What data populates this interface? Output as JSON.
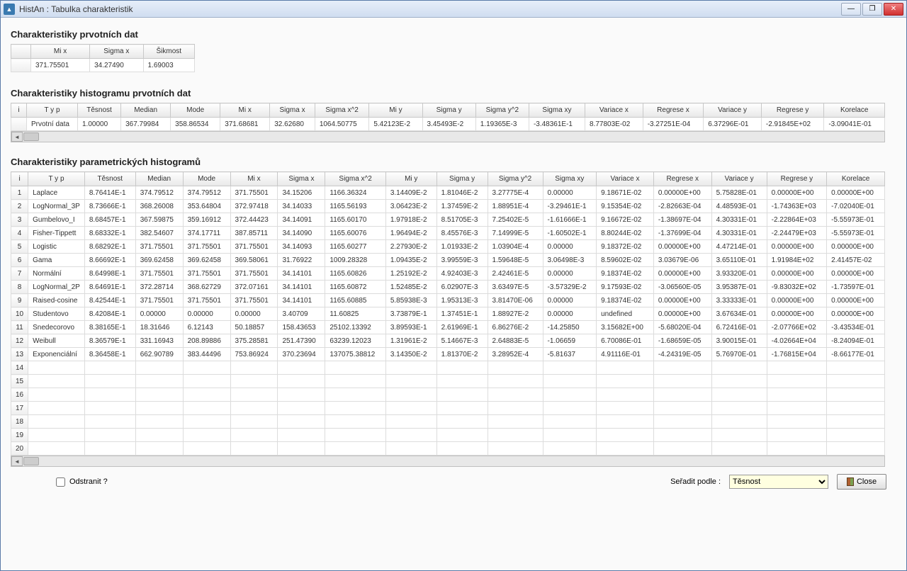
{
  "window": {
    "title": "HistAn : Tabulka charakteristik"
  },
  "section1": {
    "title": "Charakteristiky prvotních dat",
    "headers": [
      "Mi x",
      "Sigma x",
      "Šikmost"
    ],
    "row": [
      "371.75501",
      "34.27490",
      "1.69003"
    ]
  },
  "section2": {
    "title": "Charakteristiky histogramu prvotních dat",
    "headers": [
      "i",
      "T y p",
      "Těsnost",
      "Median",
      "Mode",
      "Mi x",
      "Sigma x",
      "Sigma x^2",
      "Mi y",
      "Sigma y",
      "Sigma y^2",
      "Sigma xy",
      "Variace x",
      "Regrese x",
      "Variace y",
      "Regrese y",
      "Korelace"
    ],
    "row": [
      "",
      "Prvotní data",
      "1.00000",
      "367.79984",
      "358.86534",
      "371.68681",
      "32.62680",
      "1064.50775",
      "5.42123E-2",
      "3.45493E-2",
      "1.19365E-3",
      "-3.48361E-1",
      "8.77803E-02",
      "-3.27251E-04",
      "6.37296E-01",
      "-2.91845E+02",
      "-3.09041E-01"
    ]
  },
  "section3": {
    "title": "Charakteristiky parametrických histogramů",
    "headers": [
      "i",
      "T y p",
      "Těsnost",
      "Median",
      "Mode",
      "Mi x",
      "Sigma x",
      "Sigma x^2",
      "Mi y",
      "Sigma y",
      "Sigma y^2",
      "Sigma xy",
      "Variace x",
      "Regrese x",
      "Variace y",
      "Regrese y",
      "Korelace"
    ],
    "rows": [
      [
        "1",
        "Laplace",
        "8.76414E-1",
        "374.79512",
        "374.79512",
        "371.75501",
        "34.15206",
        "1166.36324",
        "3.14409E-2",
        "1.81046E-2",
        "3.27775E-4",
        "0.00000",
        "9.18671E-02",
        "0.00000E+00",
        "5.75828E-01",
        "0.00000E+00",
        "0.00000E+00"
      ],
      [
        "2",
        "LogNormal_3P",
        "8.73666E-1",
        "368.26008",
        "353.64804",
        "372.97418",
        "34.14033",
        "1165.56193",
        "3.06423E-2",
        "1.37459E-2",
        "1.88951E-4",
        "-3.29461E-1",
        "9.15354E-02",
        "-2.82663E-04",
        "4.48593E-01",
        "-1.74363E+03",
        "-7.02040E-01"
      ],
      [
        "3",
        "Gumbelovo_I",
        "8.68457E-1",
        "367.59875",
        "359.16912",
        "372.44423",
        "34.14091",
        "1165.60170",
        "1.97918E-2",
        "8.51705E-3",
        "7.25402E-5",
        "-1.61666E-1",
        "9.16672E-02",
        "-1.38697E-04",
        "4.30331E-01",
        "-2.22864E+03",
        "-5.55973E-01"
      ],
      [
        "4",
        "Fisher-Tippett",
        "8.68332E-1",
        "382.54607",
        "374.17711",
        "387.85711",
        "34.14090",
        "1165.60076",
        "1.96494E-2",
        "8.45576E-3",
        "7.14999E-5",
        "-1.60502E-1",
        "8.80244E-02",
        "-1.37699E-04",
        "4.30331E-01",
        "-2.24479E+03",
        "-5.55973E-01"
      ],
      [
        "5",
        "Logistic",
        "8.68292E-1",
        "371.75501",
        "371.75501",
        "371.75501",
        "34.14093",
        "1165.60277",
        "2.27930E-2",
        "1.01933E-2",
        "1.03904E-4",
        "0.00000",
        "9.18372E-02",
        "0.00000E+00",
        "4.47214E-01",
        "0.00000E+00",
        "0.00000E+00"
      ],
      [
        "6",
        "Gama",
        "8.66692E-1",
        "369.62458",
        "369.62458",
        "369.58061",
        "31.76922",
        "1009.28328",
        "1.09435E-2",
        "3.99559E-3",
        "1.59648E-5",
        "3.06498E-3",
        "8.59602E-02",
        "3.03679E-06",
        "3.65110E-01",
        "1.91984E+02",
        "2.41457E-02"
      ],
      [
        "7",
        "Normální",
        "8.64998E-1",
        "371.75501",
        "371.75501",
        "371.75501",
        "34.14101",
        "1165.60826",
        "1.25192E-2",
        "4.92403E-3",
        "2.42461E-5",
        "0.00000",
        "9.18374E-02",
        "0.00000E+00",
        "3.93320E-01",
        "0.00000E+00",
        "0.00000E+00"
      ],
      [
        "8",
        "LogNormal_2P",
        "8.64691E-1",
        "372.28714",
        "368.62729",
        "372.07161",
        "34.14101",
        "1165.60872",
        "1.52485E-2",
        "6.02907E-3",
        "3.63497E-5",
        "-3.57329E-2",
        "9.17593E-02",
        "-3.06560E-05",
        "3.95387E-01",
        "-9.83032E+02",
        "-1.73597E-01"
      ],
      [
        "9",
        "Raised-cosine",
        "8.42544E-1",
        "371.75501",
        "371.75501",
        "371.75501",
        "34.14101",
        "1165.60885",
        "5.85938E-3",
        "1.95313E-3",
        "3.81470E-06",
        "0.00000",
        "9.18374E-02",
        "0.00000E+00",
        "3.33333E-01",
        "0.00000E+00",
        "0.00000E+00"
      ],
      [
        "10",
        "Studentovo",
        "8.42084E-1",
        "0.00000",
        "0.00000",
        "0.00000",
        "3.40709",
        "11.60825",
        "3.73879E-1",
        "1.37451E-1",
        "1.88927E-2",
        "0.00000",
        "undefined",
        "0.00000E+00",
        "3.67634E-01",
        "0.00000E+00",
        "0.00000E+00"
      ],
      [
        "11",
        "Snedecorovo",
        "8.38165E-1",
        "18.31646",
        "6.12143",
        "50.18857",
        "158.43653",
        "25102.13392",
        "3.89593E-1",
        "2.61969E-1",
        "6.86276E-2",
        "-14.25850",
        "3.15682E+00",
        "-5.68020E-04",
        "6.72416E-01",
        "-2.07766E+02",
        "-3.43534E-01"
      ],
      [
        "12",
        "Weibull",
        "8.36579E-1",
        "331.16943",
        "208.89886",
        "375.28581",
        "251.47390",
        "63239.12023",
        "1.31961E-2",
        "5.14667E-3",
        "2.64883E-5",
        "-1.06659",
        "6.70086E-01",
        "-1.68659E-05",
        "3.90015E-01",
        "-4.02664E+04",
        "-8.24094E-01"
      ],
      [
        "13",
        "Exponenciální",
        "8.36458E-1",
        "662.90789",
        "383.44496",
        "753.86924",
        "370.23694",
        "137075.38812",
        "3.14350E-2",
        "1.81370E-2",
        "3.28952E-4",
        "-5.81637",
        "4.91116E-01",
        "-4.24319E-05",
        "5.76970E-01",
        "-1.76815E+04",
        "-8.66177E-01"
      ]
    ],
    "empty_rows": [
      14,
      15,
      16,
      17,
      18,
      19,
      20
    ]
  },
  "footer": {
    "remove_label": "Odstranit ?",
    "sort_label": "Seřadit podle :",
    "sort_value": "Těsnost",
    "close_label": "Close"
  }
}
